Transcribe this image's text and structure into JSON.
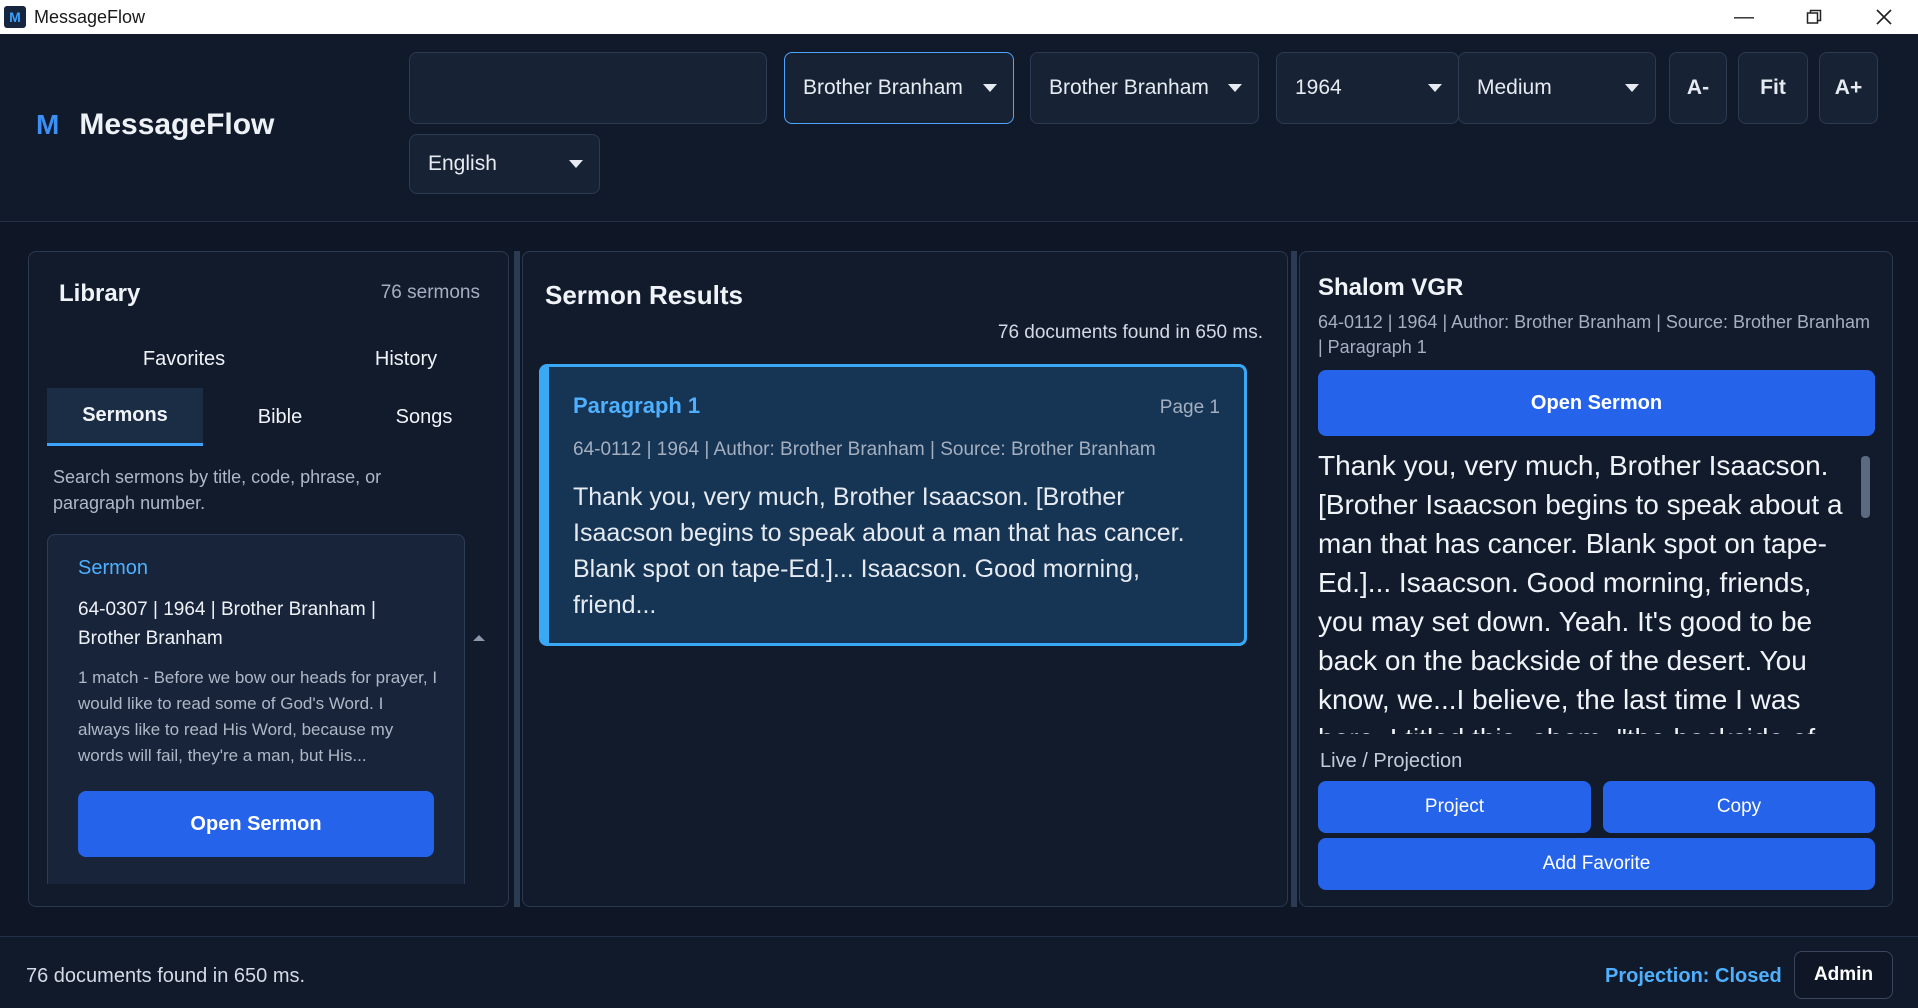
{
  "window": {
    "title": "MessageFlow"
  },
  "brand": {
    "logo": "M",
    "name": "MessageFlow"
  },
  "header": {
    "search": {
      "value": "",
      "placeholder": ""
    },
    "filters": [
      {
        "value": "Brother Branham"
      },
      {
        "value": "Brother Branham"
      },
      {
        "value": "1964"
      },
      {
        "value": "Medium"
      }
    ],
    "font_decrease": "A-",
    "font_fit": "Fit",
    "font_increase": "A+",
    "language": "English"
  },
  "library": {
    "title": "Library",
    "count": "76 sermons",
    "tabs_row1": [
      "Favorites",
      "History"
    ],
    "tabs_row2": [
      "Sermons",
      "Bible",
      "Songs"
    ],
    "active_tab": "Sermons",
    "hint": "Search sermons by title, code, phrase, or paragraph number.",
    "card": {
      "type": "Sermon",
      "meta": "64-0307 | 1964 | Brother Branham | Brother Branham",
      "snippet": "1 match - Before we bow our heads for prayer, I would like to read some of God's Word. I always like to read His Word, because my words will fail, they're a man, but His...",
      "button": "Open Sermon"
    }
  },
  "results": {
    "title": "Sermon Results",
    "count": "76 documents found in 650 ms.",
    "items": [
      {
        "paragraph": "Paragraph 1",
        "page": "Page 1",
        "meta": "64-0112 | 1964 | Author: Brother Branham | Source: Brother Branham",
        "text": "Thank you, very much, Brother Isaacson. [Brother Isaacson begins to speak about a man that has cancer. Blank spot on tape-Ed.]... Isaacson. Good morning, friend..."
      }
    ]
  },
  "detail": {
    "title": "Shalom VGR",
    "meta": "64-0112 | 1964 | Author: Brother Branham | Source: Brother Branham | Paragraph 1",
    "open_button": "Open Sermon",
    "text": "Thank you, very much, Brother Isaacson. [Brother Isaacson begins to speak about a man that has cancer. Blank spot on tape-Ed.]... Isaacson. Good morning, friends, you may set down. Yeah. It's good to be back on the backside of the desert. You know, we...I believe, the last time I was here, I titled this, ahem, \"the backside of the desert.\"",
    "live_label": "Live / Projection",
    "project_button": "Project",
    "copy_button": "Copy",
    "favorite_button": "Add Favorite"
  },
  "footer": {
    "status": "76 documents found in 650 ms.",
    "projection": "Projection: Closed",
    "admin_button": "Admin"
  },
  "colors": {
    "accent": "#2563eb",
    "highlight": "#3aa9f5",
    "link": "#4eb0ff",
    "background": "#0f1626"
  }
}
